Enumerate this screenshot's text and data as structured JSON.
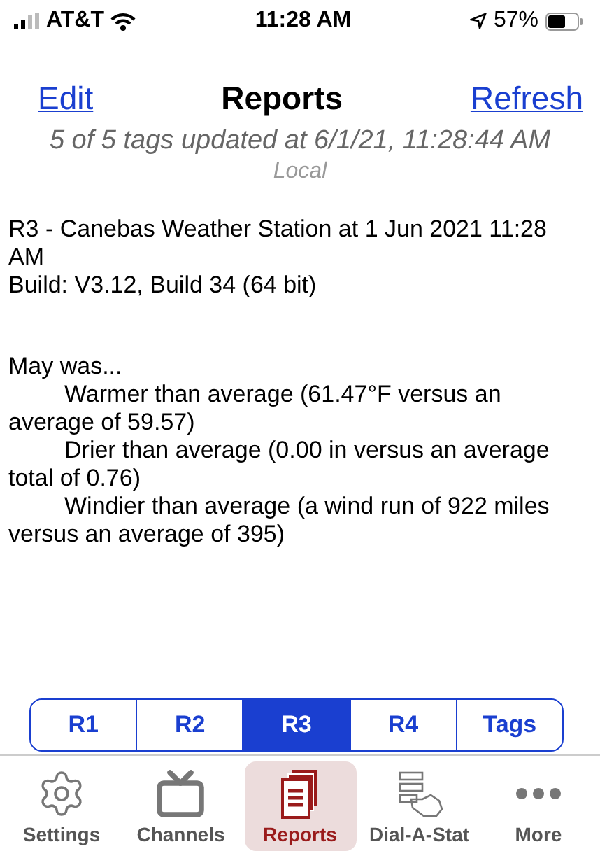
{
  "status_bar": {
    "carrier": "AT&T",
    "time": "11:28 AM",
    "battery": "57%"
  },
  "nav": {
    "left": "Edit",
    "title": "Reports",
    "right": "Refresh"
  },
  "update_status": "5 of 5 tags updated at 6/1/21, 11:28:44 AM",
  "timezone": "Local",
  "report": {
    "header_lines": [
      "R3 - Canebas Weather Station at 1 Jun 2021 11:28 AM",
      "Build: V3.12, Build 34 (64 bit)"
    ],
    "intro": "May was...",
    "items": [
      "Warmer than average (61.47°F versus an average of 59.57)",
      "Drier than average (0.00 in versus an average total of 0.76)",
      "Windier than average (a wind run of 922 miles versus an average of 395)"
    ]
  },
  "segments": [
    {
      "label": "R1",
      "selected": false
    },
    {
      "label": "R2",
      "selected": false
    },
    {
      "label": "R3",
      "selected": true
    },
    {
      "label": "R4",
      "selected": false
    },
    {
      "label": "Tags",
      "selected": false
    }
  ],
  "tab_bar": [
    {
      "label": "Settings",
      "kind": "settings",
      "selected": false
    },
    {
      "label": "Channels",
      "kind": "channels",
      "selected": false
    },
    {
      "label": "Reports",
      "kind": "reports",
      "selected": true
    },
    {
      "label": "Dial-A-Stat",
      "kind": "dial",
      "selected": false
    },
    {
      "label": "More",
      "kind": "more",
      "selected": false
    }
  ]
}
